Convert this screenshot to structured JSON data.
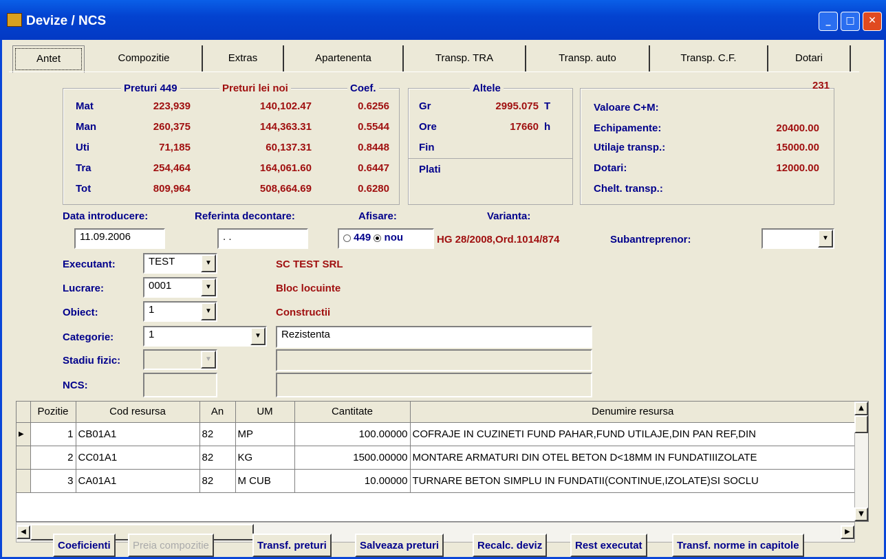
{
  "window": {
    "title": "Devize / NCS"
  },
  "tabs": [
    "Antet",
    "Compozitie",
    "Extras",
    "Apartenenta",
    "Transp. TRA",
    "Transp. auto",
    "Transp. C.F.",
    "Dotari"
  ],
  "record_number": "231",
  "prices": {
    "headers": {
      "p449": "Preturi 449",
      "plei": "Preturi lei noi",
      "coef": "Coef."
    },
    "rows": [
      {
        "label": "Mat",
        "p449": "223,939",
        "plei": "140,102.47",
        "coef": "0.6256"
      },
      {
        "label": "Man",
        "p449": "260,375",
        "plei": "144,363.31",
        "coef": "0.5544"
      },
      {
        "label": "Uti",
        "p449": "71,185",
        "plei": "60,137.31",
        "coef": "0.8448"
      },
      {
        "label": "Tra",
        "p449": "254,464",
        "plei": "164,061.60",
        "coef": "0.6447"
      },
      {
        "label": "Tot",
        "p449": "809,964",
        "plei": "508,664.69",
        "coef": "0.6280"
      }
    ]
  },
  "altele": {
    "header": "Altele",
    "gr_label": "Gr",
    "gr_value": "2995.075",
    "gr_unit": "T",
    "ore_label": "Ore",
    "ore_value": "17660",
    "ore_unit": "h",
    "fin_label": "Fin",
    "plati_label": "Plati"
  },
  "values": {
    "cm_label": "Valoare C+M:",
    "echip_label": "Echipamente:",
    "echip_value": "20400.00",
    "utilaje_label": "Utilaje transp.:",
    "utilaje_value": "15000.00",
    "dotari_label": "Dotari:",
    "dotari_value": "12000.00",
    "chelt_label": "Chelt. transp.:"
  },
  "form": {
    "data_label": "Data introducere:",
    "data_value": "11.09.2006",
    "ref_label": "Referinta decontare:",
    "ref_value": ". .",
    "afisare_label": "Afisare:",
    "radio_449": "449",
    "radio_nou": "nou",
    "varianta_label": "Varianta:",
    "varianta_value": "HG 28/2008,Ord.1014/874",
    "subantreprenor_label": "Subantreprenor:",
    "executant_label": "Executant:",
    "executant_value": "TEST",
    "executant_name": "SC TEST SRL",
    "lucrare_label": "Lucrare:",
    "lucrare_value": "0001",
    "lucrare_name": "Bloc locuinte",
    "obiect_label": "Obiect:",
    "obiect_value": "1",
    "obiect_name": "Constructii",
    "categorie_label": "Categorie:",
    "categorie_value": "1",
    "categorie_name": "Rezistenta",
    "stadiu_label": "Stadiu fizic:",
    "ncs_label": "NCS:"
  },
  "grid": {
    "columns": [
      "Pozitie",
      "Cod resursa",
      "An",
      "UM",
      "Cantitate",
      "Denumire resursa"
    ],
    "rows": [
      {
        "poz": "1",
        "cod": "CB01A1",
        "an": "82",
        "um": "MP",
        "cant": "100.00000",
        "den": "COFRAJE IN CUZINETI FUND PAHAR,FUND UTILAJE,DIN PAN REF,DIN"
      },
      {
        "poz": "2",
        "cod": "CC01A1",
        "an": "82",
        "um": "KG",
        "cant": "1500.00000",
        "den": "MONTARE ARMATURI DIN OTEL BETON D<18MM IN FUNDATIIIZOLATE"
      },
      {
        "poz": "3",
        "cod": "CA01A1",
        "an": "82",
        "um": "M CUB",
        "cant": "10.00000",
        "den": "TURNARE BETON SIMPLU IN FUNDATII(CONTINUE,IZOLATE)SI SOCLU"
      }
    ]
  },
  "buttons": [
    "Coeficienti",
    "Preia compozitie",
    "Transf. preturi",
    "Salveaza preturi",
    "Recalc. deviz",
    "Rest executat",
    "Transf. norme in capitole"
  ]
}
